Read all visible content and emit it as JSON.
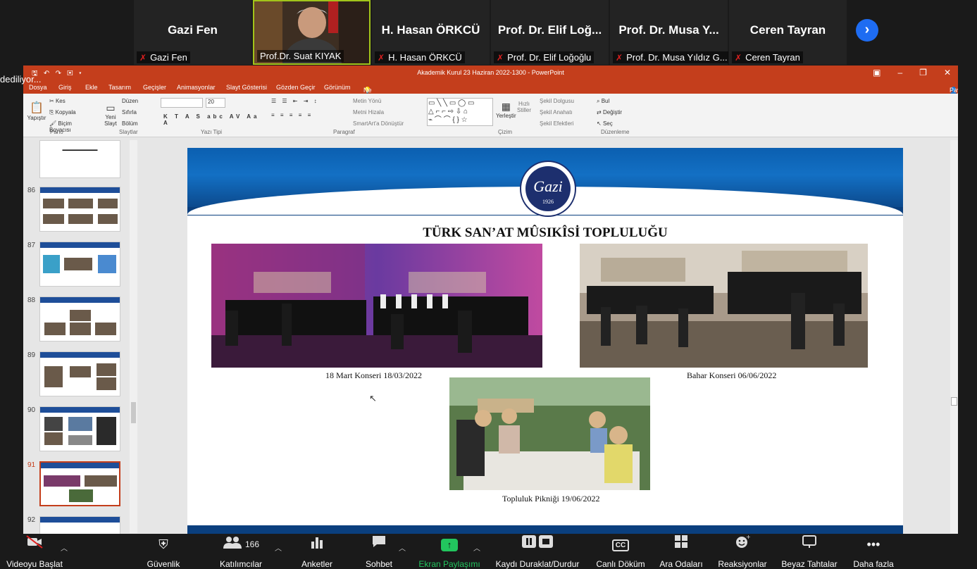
{
  "participants": [
    {
      "name": "Gazi Fen",
      "label": "Gazi Fen"
    },
    {
      "name": "",
      "label": "Prof.Dr. Suat KIYAK",
      "active": true
    },
    {
      "name": "H. Hasan ÖRKCÜ",
      "label": "H. Hasan ÖRKCÜ"
    },
    {
      "name": "Prof. Dr. Elif Loğ...",
      "label": "Prof. Dr. Elif Loğoğlu"
    },
    {
      "name": "Prof. Dr. Musa Y...",
      "label": "Prof. Dr. Musa Yıldız G..."
    },
    {
      "name": "Ceren Tayran",
      "label": "Ceren Tayran"
    }
  ],
  "notice": "dediliyor...",
  "powerpoint": {
    "window_title": "Akademik Kurul 23 Haziran 2022-1300 - PowerPoint",
    "menu": [
      "Dosya",
      "Giriş",
      "Ekle",
      "Tasarım",
      "Geçişler",
      "Animasyonlar",
      "Slayt Gösterisi",
      "Gözden Geçir",
      "Görünüm",
      "Ne yapmak istediğinizi söyleyin..."
    ],
    "share": "Paylaş",
    "ribbon": {
      "paste": "Yapıştır",
      "cut": "Kes",
      "copy": "Kopyala",
      "format_painter": "Biçim Boyacısı",
      "clipboard": "Pano",
      "new_slide": "Yeni Slayt",
      "layout": "Düzen",
      "reset": "Sıfırla",
      "section": "Bölüm",
      "slides": "Slaytlar",
      "font_size": "20",
      "font": "Yazı Tipi",
      "text_direction": "Metin Yönü",
      "align_text": "Metni Hizala",
      "smartart": "SmartArt'a Dönüştür",
      "paragraph": "Paragraf",
      "arrange": "Yerleştir",
      "quick_styles": "Hızlı Stiller",
      "fill": "Şekil Dolgusu",
      "outline": "Şekil Anahatı",
      "effects": "Şekil Efektleri",
      "drawing": "Çizim",
      "find": "Bul",
      "replace": "Değiştir",
      "select": "Seç",
      "editing": "Düzenleme"
    },
    "thumbnails": [
      {
        "num": ""
      },
      {
        "num": "86"
      },
      {
        "num": "87"
      },
      {
        "num": "88"
      },
      {
        "num": "89"
      },
      {
        "num": "90"
      },
      {
        "num": "91",
        "selected": true
      },
      {
        "num": "92"
      }
    ],
    "slide": {
      "title": "TÜRK SAN’AT MÛSIKÎSİ TOPLULUĞU",
      "logo_text": "Gazi",
      "logo_year": "1926",
      "captions": {
        "concert1": "18 Mart Konseri 18/03/2022",
        "concert2": "Bahar Konseri 06/06/2022",
        "picnic": "Topluluk Pikniği 19/06/2022"
      }
    }
  },
  "toolbar": [
    {
      "label": "Videoyu Başlat",
      "icon": "video-off-icon"
    },
    {
      "label": "Güvenlik",
      "icon": "shield-icon"
    },
    {
      "label": "Katılımcılar",
      "icon": "participants-icon",
      "count": "166"
    },
    {
      "label": "Anketler",
      "icon": "polls-icon"
    },
    {
      "label": "Sohbet",
      "icon": "chat-icon"
    },
    {
      "label": "Ekran Paylaşımı",
      "icon": "share-screen-icon",
      "color": "#22c55e"
    },
    {
      "label": "Kaydı Duraklat/Durdur",
      "icon": "record-icon"
    },
    {
      "label": "Canlı Döküm",
      "icon": "cc-icon",
      "cc": "CC"
    },
    {
      "label": "Ara Odaları",
      "icon": "rooms-icon"
    },
    {
      "label": "Reaksiyonlar",
      "icon": "reaction-icon"
    },
    {
      "label": "Beyaz Tahtalar",
      "icon": "whiteboard-icon"
    },
    {
      "label": "Daha fazla",
      "icon": "more-icon"
    }
  ]
}
